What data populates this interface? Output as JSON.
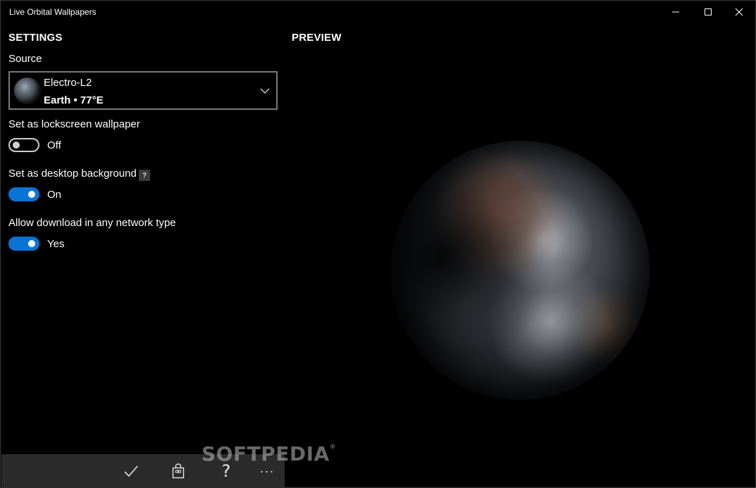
{
  "window": {
    "title": "Live Orbital Wallpapers"
  },
  "settings": {
    "heading": "SETTINGS",
    "source": {
      "label": "Source",
      "selected_name": "Electro-L2",
      "selected_detail": "Earth • 77°E"
    },
    "lockscreen": {
      "label": "Set as lockscreen wallpaper",
      "state": "Off"
    },
    "desktop": {
      "label": "Set as desktop background",
      "help": "?",
      "state": "On"
    },
    "network": {
      "label": "Allow download in any network type",
      "state": "Yes"
    }
  },
  "preview": {
    "heading": "PREVIEW"
  },
  "appbar": {
    "help_glyph": "?",
    "more_glyph": "···"
  },
  "watermark": {
    "text": "SOFTPEDIA",
    "mark": "®"
  },
  "colors": {
    "accent": "#0a74d4",
    "background": "#000000",
    "appbar": "#2b2b2b"
  },
  "icons": {
    "minimize": "minimize-icon",
    "maximize": "maximize-icon",
    "close": "close-icon",
    "dropdown": "chevron-down-icon",
    "accept": "checkmark-icon",
    "store": "shopping-bag-icon",
    "more": "more-icon"
  }
}
